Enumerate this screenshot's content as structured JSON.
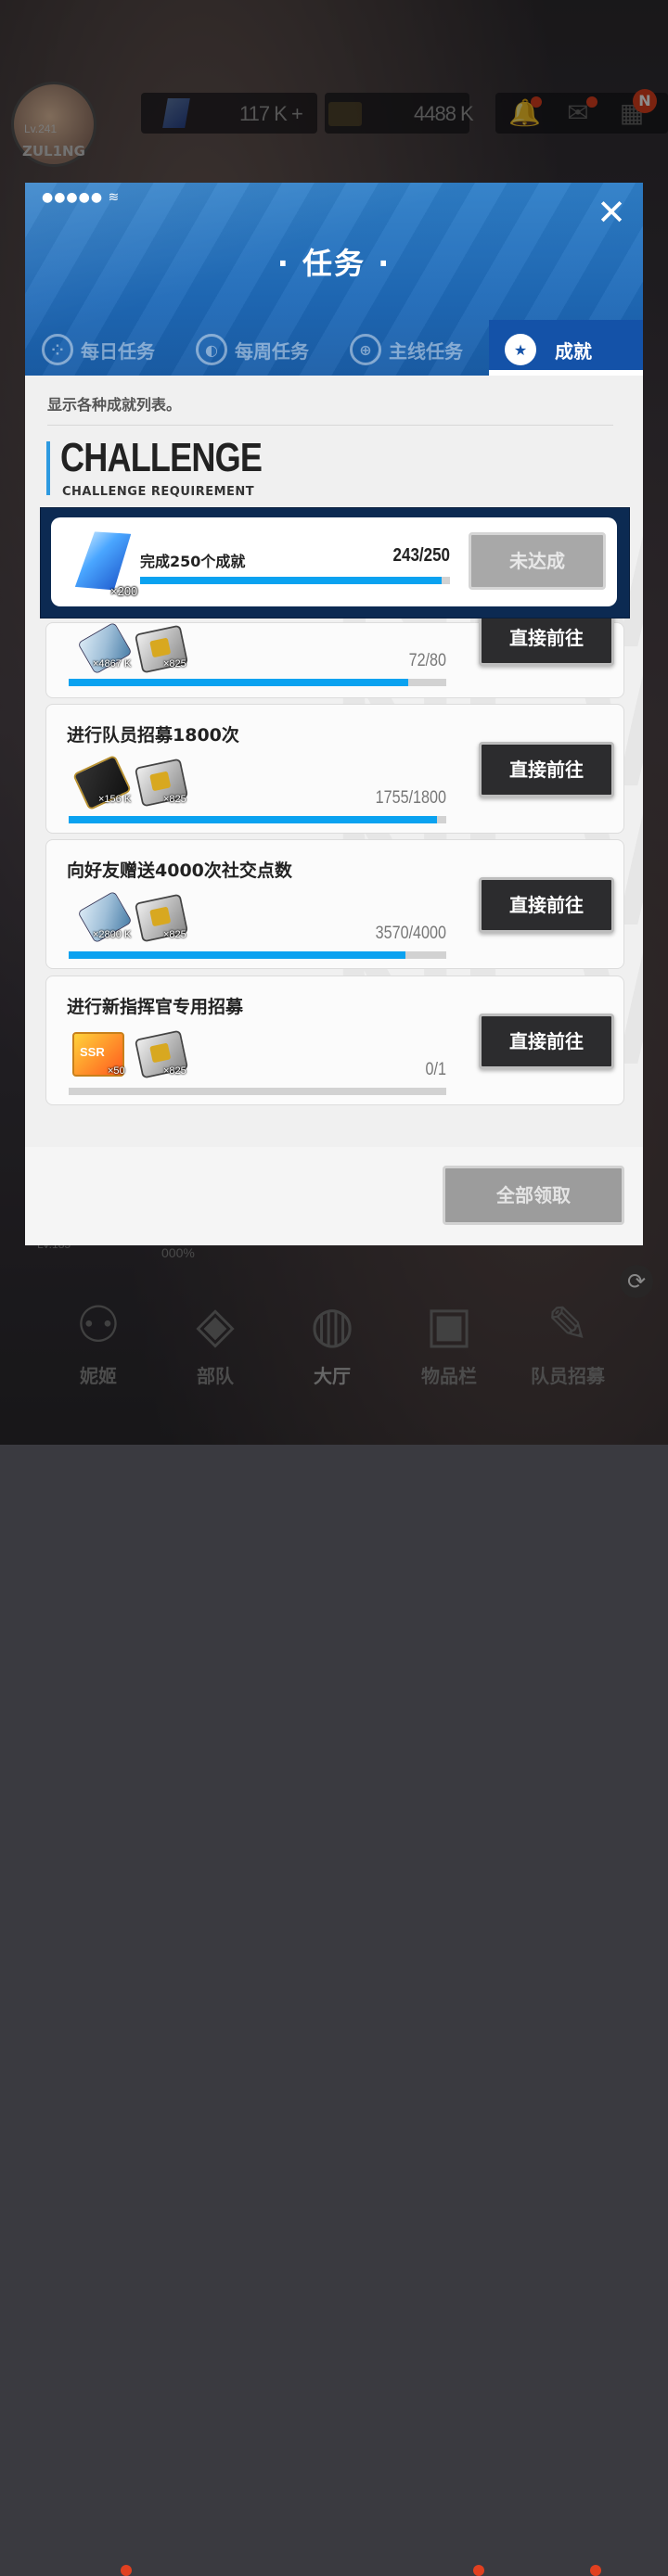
{
  "player": {
    "level": "Lv.241",
    "name": "ZUL1NG"
  },
  "resources": {
    "gems": "117 K",
    "gems_plus": "+",
    "credits": "4488 K"
  },
  "header_badge": "N",
  "modal": {
    "status_dots": "●●●●●",
    "title": "· 任务 ·",
    "tabs": [
      {
        "label": "每日任务",
        "icon": "daily-icon"
      },
      {
        "label": "每周任务",
        "icon": "weekly-icon"
      },
      {
        "label": "主线任务",
        "icon": "globe-icon"
      },
      {
        "label": "成就",
        "icon": "star-icon"
      }
    ],
    "active_tab": "成就",
    "description": "显示各种成就列表。",
    "challenge_title": "CHALLENGE",
    "challenge_subtitle": "CHALLENGE REQUIREMENT",
    "highlight": {
      "title": "完成250个成就",
      "count": "243/250",
      "progress": 0.972,
      "reward_qty": "×200",
      "button": "未达成"
    },
    "achievements": [
      {
        "title": "",
        "count": "72/80",
        "progress": 0.9,
        "rewards": [
          {
            "type": "usb",
            "qty": "×4867 K"
          },
          {
            "type": "core",
            "qty": "×825"
          }
        ],
        "button": "直接前往"
      },
      {
        "title": "进行队员招募1800次",
        "count": "1755/1800",
        "progress": 0.975,
        "rewards": [
          {
            "type": "coin",
            "qty": "×156 K"
          },
          {
            "type": "core",
            "qty": "×825"
          }
        ],
        "button": "直接前往"
      },
      {
        "title": "向好友赠送4000次社交点数",
        "count": "3570/4000",
        "progress": 0.8925,
        "rewards": [
          {
            "type": "usb",
            "qty": "×2800 K"
          },
          {
            "type": "core",
            "qty": "×825"
          }
        ],
        "button": "直接前往"
      },
      {
        "title": "进行新指挥官专用招募",
        "count": "0/1",
        "progress": 0,
        "rewards": [
          {
            "type": "ssr",
            "qty": "×50"
          },
          {
            "type": "core",
            "qty": "×825"
          }
        ],
        "button": "直接前往"
      }
    ],
    "claim_all": "全部领取"
  },
  "bottom_nav": [
    {
      "label": "妮姬"
    },
    {
      "label": "部队"
    },
    {
      "label": "大厅"
    },
    {
      "label": "物品栏"
    },
    {
      "label": "队员招募"
    }
  ],
  "behind": {
    "level_tag": "LV.185",
    "percent": "000%"
  },
  "colors": {
    "accent_blue": "#0aa2f0",
    "header_blue": "#1f6ab8",
    "active_tab": "#1452a8"
  }
}
